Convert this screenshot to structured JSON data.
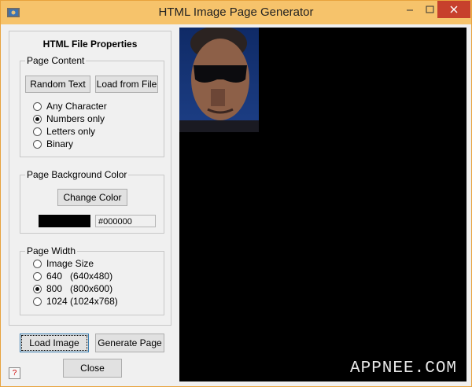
{
  "window": {
    "title": "HTML Image Page Generator"
  },
  "panel": {
    "title": "HTML File Properties",
    "page_content": {
      "legend": "Page Content",
      "random_text_label": "Random Text",
      "load_from_file_label": "Load from File",
      "options": [
        "Any Character",
        "Numbers only",
        "Letters only",
        "Binary"
      ],
      "selected": "Numbers only"
    },
    "background": {
      "legend": "Page Background Color",
      "change_color_label": "Change Color",
      "color_hex": "#000000"
    },
    "width": {
      "legend": "Page Width",
      "options": [
        "Image Size",
        "640   (640x480)",
        "800   (800x600)",
        "1024 (1024x768)"
      ],
      "selected": "800   (800x600)"
    }
  },
  "buttons": {
    "load_image": "Load Image",
    "generate_page": "Generate Page",
    "close": "Close",
    "help": "?"
  },
  "watermark": "APPNEE.COM",
  "colors": {
    "titlebar": "#f6c36b",
    "close_button": "#c7402c",
    "preview_bg": "#000000"
  }
}
